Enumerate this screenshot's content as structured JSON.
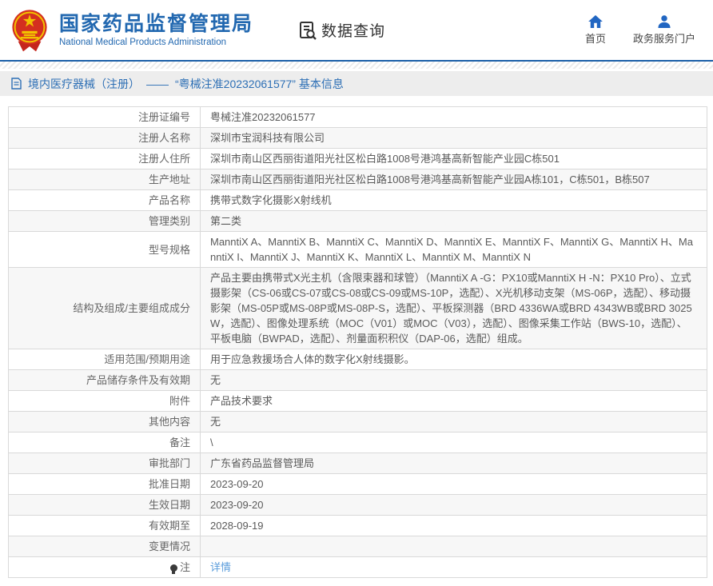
{
  "colors": {
    "accent_blue": "#2268b0",
    "nav_icon_blue": "#2166c2",
    "link_blue": "#5a9cdb",
    "emblem_red": "#d42f1f",
    "emblem_gold": "#f2c200",
    "breadcrumb_bg": "#ededed",
    "row_stripe": "#f7f7f7",
    "divider_blue": "#1b5fa8"
  },
  "header": {
    "agency_name_zh": "国家药品监督管理局",
    "agency_name_en": "National Medical Products Administration",
    "section_title": "数据查询",
    "nav": {
      "home_label": "首页",
      "portal_label": "政务服务门户"
    }
  },
  "breadcrumb": {
    "category": "境内医疗器械（注册）",
    "separator": "——",
    "title": "“粤械注准20232061577” 基本信息"
  },
  "table": {
    "rows": [
      {
        "label": "注册证编号",
        "value": "粤械注准20232061577"
      },
      {
        "label": "注册人名称",
        "value": "深圳市宝润科技有限公司"
      },
      {
        "label": "注册人住所",
        "value": "深圳市南山区西丽街道阳光社区松白路1008号港鸿基高新智能产业园C栋501"
      },
      {
        "label": "生产地址",
        "value": "深圳市南山区西丽街道阳光社区松白路1008号港鸿基高新智能产业园A栋101，C栋501，B栋507"
      },
      {
        "label": "产品名称",
        "value": "携带式数字化摄影X射线机"
      },
      {
        "label": "管理类别",
        "value": "第二类"
      },
      {
        "label": "型号规格",
        "value": "ManntiX A、ManntiX B、ManntiX C、ManntiX D、ManntiX E、ManntiX F、ManntiX G、ManntiX H、ManntiX I、ManntiX J、ManntiX K、ManntiX L、ManntiX M、ManntiX N"
      },
      {
        "label": "结构及组成/主要组成成分",
        "value": "产品主要由携带式X光主机（含限束器和球管）（ManntiX A -G：PX10或ManntiX H -N：PX10 Pro）、立式摄影架（CS-06或CS-07或CS-08或CS-09或MS-10P，选配）、X光机移动支架（MS-06P，选配）、移动摄影架（MS-05P或MS-08P或MS-08P-S，选配）、平板探测器（BRD 4336WA或BRD 4343WB或BRD 3025W，选配）、图像处理系统（MOC（V01）或MOC（V03），选配）、图像采集工作站（BWS-10，选配）、平板电脑（BWPAD，选配）、剂量面积积仪（DAP-06，选配）组成。"
      },
      {
        "label": "适用范围/预期用途",
        "value": "用于应急救援场合人体的数字化X射线摄影。"
      },
      {
        "label": "产品储存条件及有效期",
        "value": "无"
      },
      {
        "label": "附件",
        "value": "产品技术要求"
      },
      {
        "label": "其他内容",
        "value": "无"
      },
      {
        "label": "备注",
        "value": "\\"
      },
      {
        "label": "审批部门",
        "value": "广东省药品监督管理局"
      },
      {
        "label": "批准日期",
        "value": "2023-09-20"
      },
      {
        "label": "生效日期",
        "value": "2023-09-20"
      },
      {
        "label": "有效期至",
        "value": "2028-09-19"
      },
      {
        "label": "变更情况",
        "value": ""
      },
      {
        "label": "注",
        "value": "详情",
        "link": true,
        "icon": "note-icon"
      }
    ]
  }
}
